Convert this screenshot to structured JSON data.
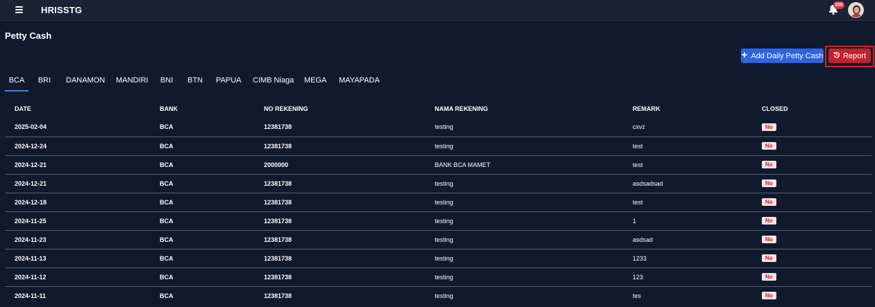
{
  "app": {
    "title": "HRISSTG",
    "notification_count": "205"
  },
  "page": {
    "title": "Petty Cash"
  },
  "actions": {
    "add_label": "Add Daily Petty Cash",
    "report_label": "Report"
  },
  "tabs": [
    "BCA",
    "BRI",
    "DANAMON",
    "MANDIRI",
    "BNI",
    "BTN",
    "PAPUA",
    "CIMB Niaga",
    "MEGA",
    "MAYAPADA"
  ],
  "active_tab": "BCA",
  "table": {
    "headers": [
      "DATE",
      "BANK",
      "NO REKENING",
      "NAMA REKENING",
      "REMARK",
      "CLOSED"
    ],
    "rows": [
      [
        "2025-02-04",
        "BCA",
        "12381738",
        "testing",
        "cxvz",
        "No"
      ],
      [
        "2024-12-24",
        "BCA",
        "12381738",
        "testing",
        "test",
        "No"
      ],
      [
        "2024-12-21",
        "BCA",
        "2000000",
        "BANK BCA MAMET",
        "test",
        "No"
      ],
      [
        "2024-12-21",
        "BCA",
        "12381738",
        "testing",
        "asdsadsad",
        "No"
      ],
      [
        "2024-12-18",
        "BCA",
        "12381738",
        "testing",
        "test",
        "No"
      ],
      [
        "2024-11-25",
        "BCA",
        "12381738",
        "testing",
        "1",
        "No"
      ],
      [
        "2024-11-23",
        "BCA",
        "12381738",
        "testing",
        "asdsad",
        "No"
      ],
      [
        "2024-11-13",
        "BCA",
        "12381738",
        "testing",
        "1233",
        "No"
      ],
      [
        "2024-11-12",
        "BCA",
        "12381738",
        "testing",
        "123",
        "No"
      ],
      [
        "2024-11-11",
        "BCA",
        "12381738",
        "testing",
        "tes",
        "No"
      ]
    ]
  },
  "colors": {
    "background": "#111a2c",
    "topbar": "#1a2233",
    "primary": "#2f64e0",
    "danger": "#c0232b",
    "badge_bg": "#fde2e2"
  }
}
